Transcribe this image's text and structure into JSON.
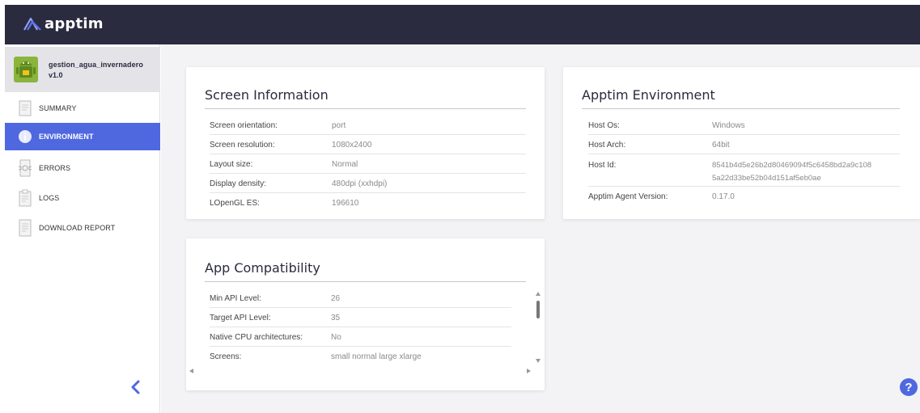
{
  "brand": {
    "name": "apptim"
  },
  "app": {
    "name": "gestion_agua_invernadero",
    "version": "v1.0"
  },
  "nav": [
    {
      "label": "SUMMARY",
      "icon": "summary-doc-icon"
    },
    {
      "label": "ENVIRONMENT",
      "icon": "info-icon",
      "active": true
    },
    {
      "label": "ERRORS",
      "icon": "bug-icon"
    },
    {
      "label": "LOGS",
      "icon": "logs-clipboard-icon"
    },
    {
      "label": "DOWNLOAD REPORT",
      "icon": "report-doc-icon"
    }
  ],
  "screen_info": {
    "title": "Screen Information",
    "rows": [
      {
        "label": "Screen orientation:",
        "value": "port"
      },
      {
        "label": "Screen resolution:",
        "value": "1080x2400"
      },
      {
        "label": "Layout size:",
        "value": "Normal"
      },
      {
        "label": "Display density:",
        "value": "480dpi (xxhdpi)"
      },
      {
        "label": "LOpenGL ES:",
        "value": "196610"
      }
    ]
  },
  "environment": {
    "title": "Apptim Environment",
    "rows": [
      {
        "label": "Host Os:",
        "value": "Windows"
      },
      {
        "label": "Host Arch:",
        "value": "64bit"
      },
      {
        "label": "Host Id:",
        "value": "8541b4d5e26b2d80469094f5c6458bd2a9c108",
        "value2": "5a22d33be52b04d151af5eb0ae"
      },
      {
        "label": "Apptim Agent Version:",
        "value": "0.17.0"
      }
    ]
  },
  "compat": {
    "title": "App Compatibility",
    "rows": [
      {
        "label": "Min API Level:",
        "value": "26"
      },
      {
        "label": "Target API Level:",
        "value": "35"
      },
      {
        "label": "Native CPU architectures:",
        "value": "No"
      },
      {
        "label": "Screens:",
        "value": "small normal large xlarge"
      }
    ]
  },
  "help": {
    "label": "?"
  },
  "colors": {
    "topbar": "#2a2b3e",
    "accent": "#4f68e0",
    "background": "#f3f3f5"
  }
}
